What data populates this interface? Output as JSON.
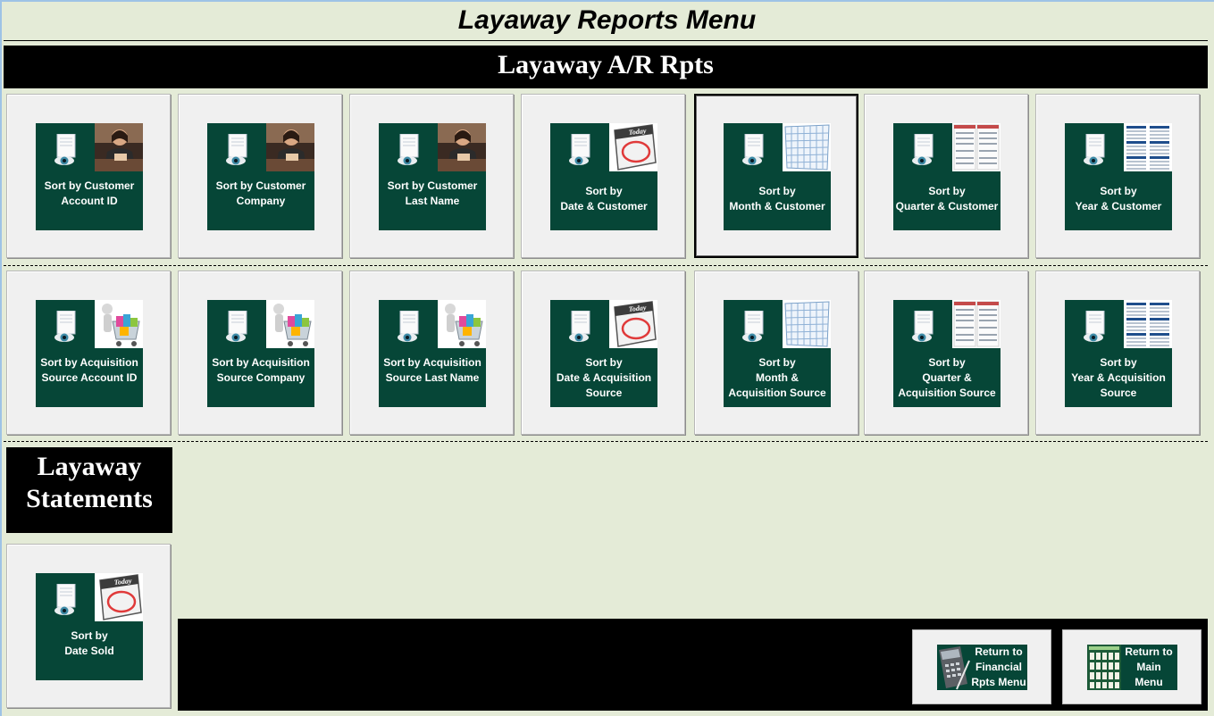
{
  "title": "Layaway Reports Menu",
  "ar_section": {
    "title": "Layaway A/R Rpts"
  },
  "customer_row": [
    {
      "line1": "Sort by Customer",
      "line2": "Account ID",
      "image": "customer-photo-icon"
    },
    {
      "line1": "Sort by Customer",
      "line2": "Company",
      "image": "customer-photo-icon"
    },
    {
      "line1": "Sort by Customer",
      "line2": "Last Name",
      "image": "customer-photo-icon"
    },
    {
      "line1": "Sort by",
      "line2": "Date & Customer",
      "image": "today-calendar-icon"
    },
    {
      "line1": "Sort by",
      "line2": "Month & Customer",
      "image": "month-calendar-icon"
    },
    {
      "line1": "Sort by",
      "line2": "Quarter & Customer",
      "image": "quarter-calendar-icon"
    },
    {
      "line1": "Sort by",
      "line2": "Year & Customer",
      "image": "year-calendar-icon"
    }
  ],
  "acquisition_row": [
    {
      "line1": "Sort by Acquisition",
      "line2": "Source Account ID",
      "image": "shopping-cart-icon"
    },
    {
      "line1": "Sort by Acquisition",
      "line2": "Source Company",
      "image": "shopping-cart-icon"
    },
    {
      "line1": "Sort by Acquisition",
      "line2": "Source Last Name",
      "image": "shopping-cart-icon"
    },
    {
      "line1": "Sort by",
      "line2": "Date & Acquisition",
      "line3": "Source",
      "image": "today-calendar-icon"
    },
    {
      "line1": "Sort by",
      "line2": "Month &",
      "line3": "Acquisition Source",
      "image": "month-calendar-icon"
    },
    {
      "line1": "Sort by",
      "line2": "Quarter &",
      "line3": "Acquisition Source",
      "image": "quarter-calendar-icon"
    },
    {
      "line1": "Sort by",
      "line2": "Year & Acquisition",
      "line3": "Source",
      "image": "year-calendar-icon"
    }
  ],
  "statements": {
    "title_line1": "Layaway",
    "title_line2": "Statements",
    "button": {
      "line1": "Sort by",
      "line2": "Date Sold",
      "image": "today-calendar-icon"
    }
  },
  "nav": {
    "financial": {
      "line1": "Return to",
      "line2": "Financial",
      "line3": "Rpts Menu",
      "image": "calculator-icon"
    },
    "main": {
      "line1": "Return to",
      "line2": "Main",
      "line3": "Menu",
      "image": "menu-grid-icon"
    }
  },
  "colors": {
    "tile": "#064637",
    "background": "#e4ebd7",
    "band": "#000000"
  }
}
